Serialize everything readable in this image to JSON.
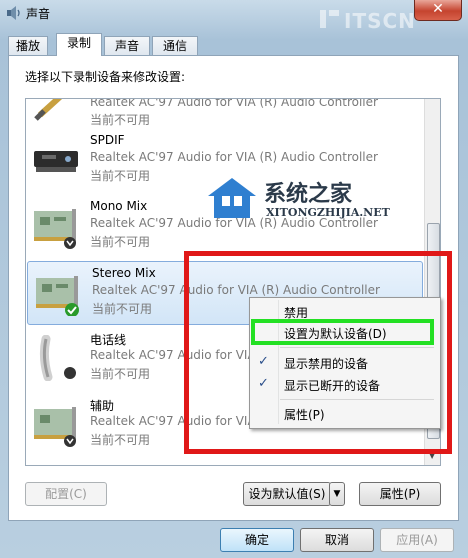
{
  "window": {
    "title": "声音",
    "close_glyph": "✕"
  },
  "watermarks": {
    "top_text": "ITSCN",
    "logo_cn": "系统之家",
    "logo_en": "XITONGZHIJIA.NET"
  },
  "tabs": [
    {
      "label": "播放",
      "active": false
    },
    {
      "label": "录制",
      "active": true
    },
    {
      "label": "声音",
      "active": false
    },
    {
      "label": "通信",
      "active": false
    }
  ],
  "instruction": "选择以下录制设备来修改设置:",
  "devices": [
    {
      "name": "",
      "description": "Realtek AC'97 Audio for VIA (R) Audio Controller",
      "status": "当前不可用",
      "icon": "line-in-jack-icon"
    },
    {
      "name": "SPDIF",
      "description": "Realtek AC'97 Audio for VIA (R) Audio Controller",
      "status": "当前不可用",
      "icon": "spdif-device-icon"
    },
    {
      "name": "Mono Mix",
      "description": "Realtek AC'97 Audio for VIA (R) Audio Controller",
      "status": "当前不可用",
      "icon": "sound-card-icon"
    },
    {
      "name": "Stereo Mix",
      "description": "Realtek AC'97 Audio for VIA (R) Audio Controller",
      "status": "当前不可用",
      "icon": "sound-card-icon",
      "selected": true
    },
    {
      "name": "电话线",
      "description": "Realtek AC'97 Audio for VIA (R) Audio Controller",
      "status": "当前不可用",
      "icon": "telephone-icon"
    },
    {
      "name": "辅助",
      "description": "Realtek AC'97 Audio for VIA (R) Audio Controller",
      "status": "当前不可用",
      "icon": "sound-card-icon"
    }
  ],
  "context_menu": {
    "items": [
      {
        "label": "禁用",
        "checked": false
      },
      {
        "label": "设置为默认设备(D)",
        "checked": false,
        "highlighted": true
      },
      {
        "label": "显示禁用的设备",
        "checked": true
      },
      {
        "label": "显示已断开的设备",
        "checked": true
      },
      {
        "label": "属性(P)",
        "checked": false
      }
    ]
  },
  "buttons": {
    "configure": "配置(C)",
    "set_default": "设为默认值(S)",
    "set_default_arrow": "▼",
    "properties": "属性(P)",
    "ok": "确定",
    "cancel": "取消",
    "apply": "应用(A)"
  },
  "colors": {
    "annotation_red": "#e01818",
    "annotation_green": "#23e023",
    "selection": "#d2e5f7"
  }
}
